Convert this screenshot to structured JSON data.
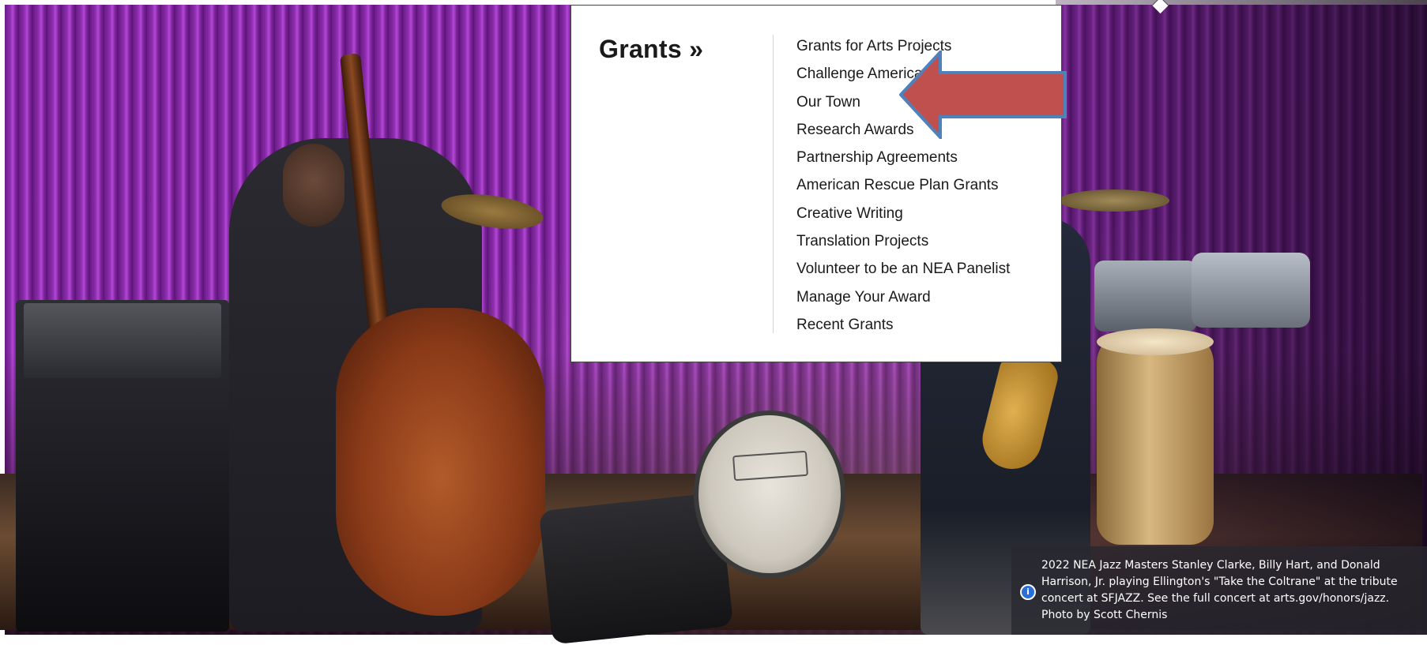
{
  "hero": {
    "image_description_alt": "",
    "colors": {
      "backdrop_purple": "#8e2fb0",
      "menu_arrow_fill": "#c0504d",
      "menu_arrow_stroke": "#4f81bd"
    }
  },
  "dropdown": {
    "heading": "Grants »",
    "items": [
      {
        "label": "Grants for Arts Projects"
      },
      {
        "label": "Challenge America"
      },
      {
        "label": "Our Town"
      },
      {
        "label": "Research Awards"
      },
      {
        "label": "Partnership Agreements"
      },
      {
        "label": "American Rescue Plan Grants"
      },
      {
        "label": "Creative Writing"
      },
      {
        "label": "Translation Projects"
      },
      {
        "label": "Volunteer to be an NEA Panelist"
      },
      {
        "label": "Manage Your Award"
      },
      {
        "label": "Recent Grants"
      }
    ]
  },
  "annotation": {
    "icon": "left-arrow-icon",
    "points_to": "Our Town"
  },
  "caption": {
    "icon": "info-icon",
    "icon_glyph": "i",
    "text": "2022 NEA Jazz Masters Stanley Clarke, Billy Hart, and Donald Harrison, Jr. playing Ellington's \"Take the Coltrane\" at the tribute concert at SFJAZZ. See the full concert at arts.gov/honors/jazz. Photo by Scott Chernis"
  }
}
